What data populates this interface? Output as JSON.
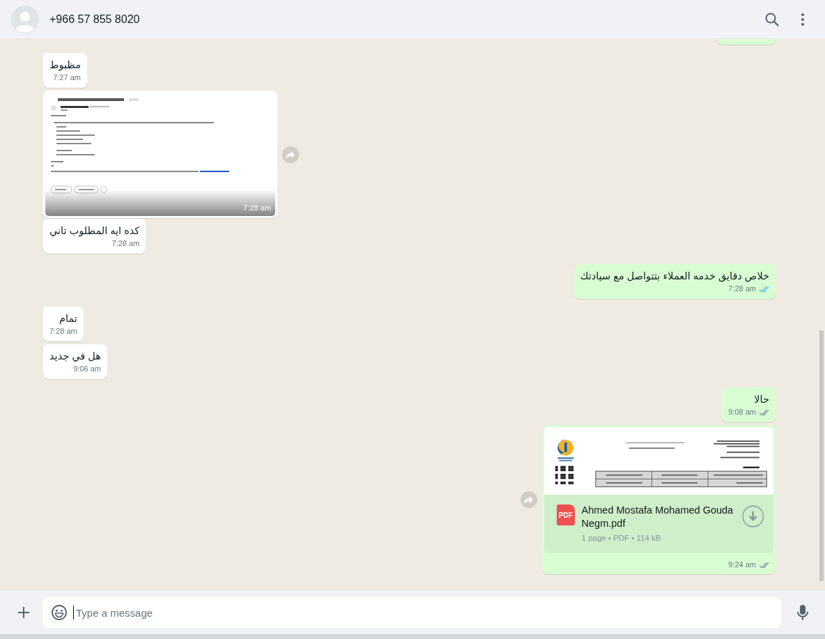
{
  "header": {
    "contact": "+966 57 855 8020"
  },
  "messages": [
    {
      "kind": "partial",
      "outgoing": true
    },
    {
      "kind": "text",
      "outgoing": false,
      "text": "مظبوط",
      "time": "7:27 am",
      "tail": true
    },
    {
      "kind": "image",
      "outgoing": false,
      "time": "7:28 am",
      "tail": false,
      "forward": true
    },
    {
      "kind": "text",
      "outgoing": false,
      "text": "كده ايه المطلوب تاني",
      "time": "7:28 am",
      "tail": false
    },
    {
      "kind": "text",
      "outgoing": true,
      "text": "خلاص دقايق خدمه العملاء بتتواصل مع سيادتك",
      "time": "7:28 am",
      "tail": true,
      "read": true
    },
    {
      "kind": "text",
      "outgoing": false,
      "text": "تمام",
      "time": "7:28 am",
      "tail": true
    },
    {
      "kind": "text",
      "outgoing": false,
      "text": "هل في جديد",
      "time": "9:06 am",
      "tail": false
    },
    {
      "kind": "text",
      "outgoing": true,
      "text": "حالا",
      "time": "9:08 am",
      "tail": true,
      "read": false
    },
    {
      "kind": "document",
      "outgoing": true,
      "time": "9:24 am",
      "tail": false,
      "read": false,
      "forward": true,
      "badge": "PDF",
      "file_name": "Ahmed Mostafa Mohamed Gouda Negm.pdf",
      "meta": "1 page • PDF • 114 kB"
    }
  ],
  "composer": {
    "placeholder": "Type a message"
  }
}
